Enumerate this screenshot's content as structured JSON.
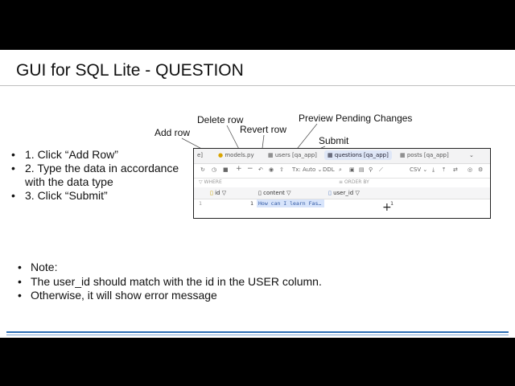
{
  "slide": {
    "title": "GUI for SQL Lite - QUESTION",
    "steps": [
      "1. Click “Add Row”",
      "2. Type the data in accordance with the data type",
      "3. Click “Submit”"
    ],
    "notes": [
      "Note:",
      "The user_id should match with the id in the USER column.",
      "Otherwise, it will show error message"
    ],
    "callouts": {
      "add_row": "Add row",
      "delete_row": "Delete row",
      "revert_row": "Revert row",
      "preview": "Preview Pending Changes",
      "submit": "Submit"
    }
  },
  "ide": {
    "tabs": [
      {
        "label": "e]",
        "icon": "file-icon"
      },
      {
        "label": "models.py",
        "icon": "python-icon"
      },
      {
        "label": "users [qa_app]",
        "icon": "table-icon"
      },
      {
        "label": "questions [qa_app]",
        "icon": "table-icon",
        "active": true
      },
      {
        "label": "posts [qa_app]",
        "icon": "table-icon"
      }
    ],
    "toolbar": {
      "tx_mode": "Tx: Auto",
      "ddl": "DDL",
      "export_format": "CSV"
    },
    "filter": {
      "where": "WHERE",
      "order_by": "ORDER BY"
    },
    "columns": [
      "id",
      "content",
      "user_id"
    ],
    "rows": [
      {
        "row_num": "1",
        "id": "1",
        "content": "How can I learn Fas…",
        "user_id": "1"
      }
    ]
  },
  "colors": {
    "accent": "#2e6fb5",
    "selection": "#d7e4fb"
  }
}
